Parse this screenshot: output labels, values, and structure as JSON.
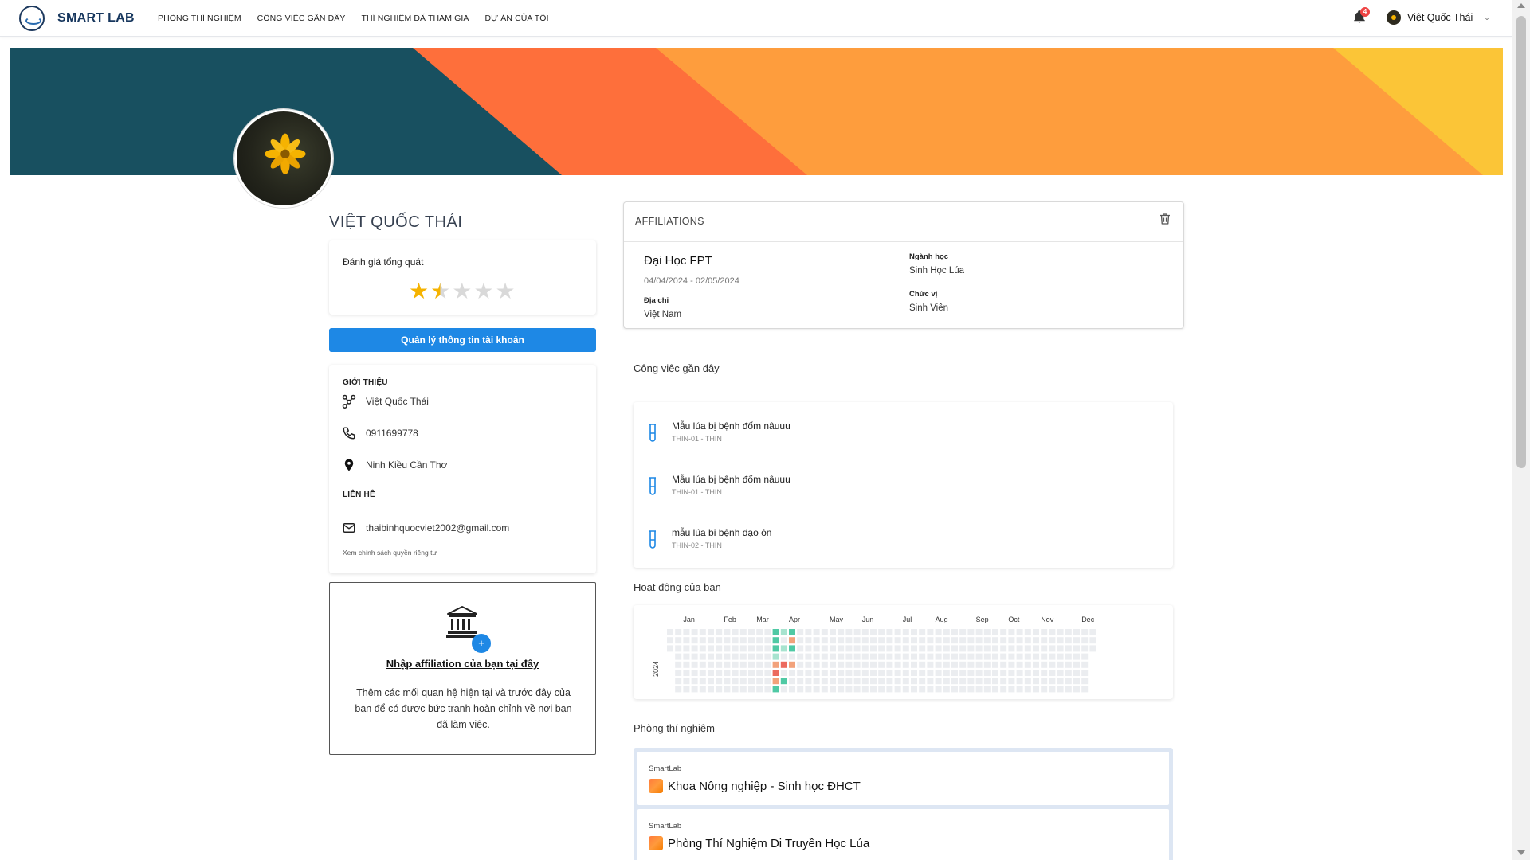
{
  "nav": {
    "brand": "SMART LAB",
    "menu": [
      "PHÒNG THÍ NGHIỆM",
      "CÔNG VIỆC GẦN ĐÂY",
      "THÍ NGHIỆM ĐÃ THAM GIA",
      "DỰ ÁN CỦA TÔI"
    ],
    "notifications": "4",
    "user_name": "Việt Quốc Thái"
  },
  "profile": {
    "name": "VIỆT QUỐC THÁI",
    "rating_label": "Đánh giá tổng quát",
    "rating": 1.5,
    "rating_max": 5,
    "manage_button": "Quản lý thông tin tài khoản",
    "intro_label": "GIỚI THIỆU",
    "display_name": "Việt Quốc Thái",
    "phone": "0911699778",
    "location": "Ninh Kiều Cần Thơ",
    "contact_label": "LIÊN HỆ",
    "email": "thaibinhquocviet2002@gmail.com",
    "privacy_link": "Xem chính sách quyền riêng tư"
  },
  "affiliation_empty": {
    "link": "Nhập affiliation của bạn tại đây",
    "description": "Thêm các mối quan hệ hiện tại và trước đây của bạn để có được bức tranh hoàn chỉnh về nơi bạn đã làm việc."
  },
  "affiliations": {
    "title": "AFFILIATIONS",
    "school": "Đại Học FPT",
    "dates": "04/04/2024 - 02/05/2024",
    "address_label": "Địa chỉ",
    "address": "Việt Nam",
    "major_label": "Ngành học",
    "major": "Sinh Học Lúa",
    "position_label": "Chức vị",
    "position": "Sinh Viên"
  },
  "recent_jobs": {
    "title": "Công việc gần đây",
    "items": [
      {
        "title": "Mẫu lúa bị bệnh đốm nâuuu",
        "code": "THIN-01 - THIN"
      },
      {
        "title": "Mẫu lúa bị bệnh đốm nâuuu",
        "code": "THIN-01 - THIN"
      },
      {
        "title": "mẫu lúa bị bệnh đạo ôn",
        "code": "THIN-02 - THIN"
      }
    ]
  },
  "activity": {
    "title": "Hoạt động của bạn",
    "year": "2024",
    "months": [
      "Jan",
      "Feb",
      "Mar",
      "Apr",
      "May",
      "Jun",
      "Jul",
      "Aug",
      "Sep",
      "Oct",
      "Nov",
      "Dec"
    ],
    "active_cells": [
      {
        "week": 13,
        "day": 0,
        "level": "green"
      },
      {
        "week": 13,
        "day": 1,
        "level": "green"
      },
      {
        "week": 13,
        "day": 2,
        "level": "green"
      },
      {
        "week": 13,
        "day": 3,
        "level": "light-green"
      },
      {
        "week": 13,
        "day": 4,
        "level": "orange"
      },
      {
        "week": 13,
        "day": 5,
        "level": "red"
      },
      {
        "week": 13,
        "day": 6,
        "level": "orange"
      },
      {
        "week": 13,
        "day": 7,
        "level": "green"
      },
      {
        "week": 14,
        "day": 0,
        "level": "light-green"
      },
      {
        "week": 14,
        "day": 2,
        "level": "light-green"
      },
      {
        "week": 14,
        "day": 4,
        "level": "red"
      },
      {
        "week": 14,
        "day": 6,
        "level": "green"
      },
      {
        "week": 15,
        "day": 0,
        "level": "green"
      },
      {
        "week": 15,
        "day": 1,
        "level": "orange"
      },
      {
        "week": 15,
        "day": 2,
        "level": "green"
      },
      {
        "week": 15,
        "day": 4,
        "level": "orange"
      }
    ],
    "colors": {
      "empty": "#ebedf0",
      "green": "#4fc9a4",
      "light-green": "#a7e3cf",
      "orange": "#f2a27b",
      "red": "#ec6a5e"
    }
  },
  "labs": {
    "title": "Phòng thí nghiệm",
    "items": [
      {
        "source": "SmartLab",
        "name": "Khoa Nông nghiệp - Sinh học ĐHCT"
      },
      {
        "source": "SmartLab",
        "name": "Phòng Thí Nghiệm Di Truyền Học Lúa"
      }
    ]
  }
}
